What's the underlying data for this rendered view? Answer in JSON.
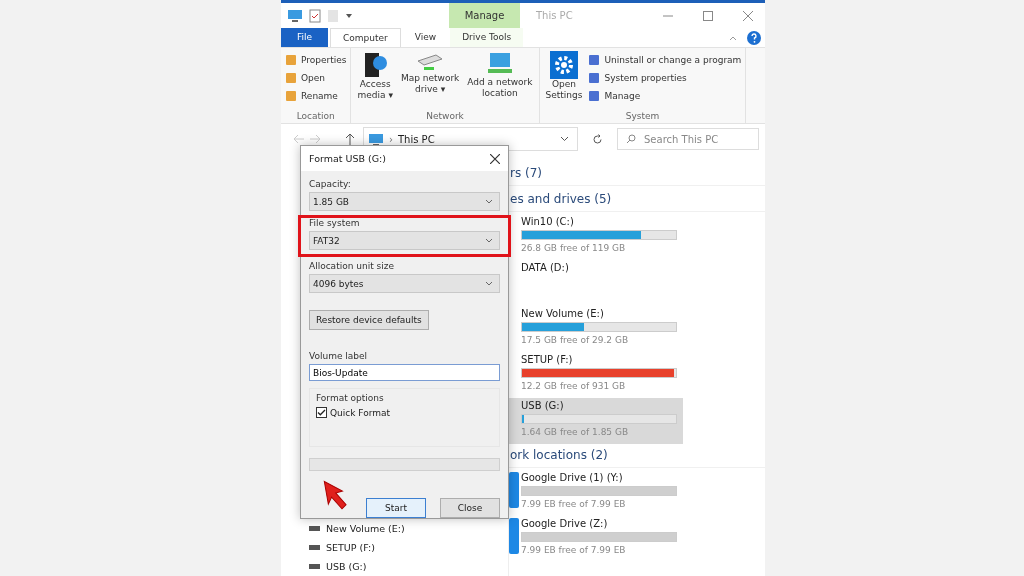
{
  "titlebar": {
    "context_tab": "Manage",
    "title": "This PC"
  },
  "ribbon_tabs": [
    {
      "label": "File",
      "kind": "file",
      "selected": false
    },
    {
      "label": "Computer",
      "kind": "tab",
      "selected": true
    },
    {
      "label": "View",
      "kind": "tab",
      "selected": false
    },
    {
      "label": "Drive Tools",
      "kind": "context",
      "selected": false
    }
  ],
  "ribbon_groups": [
    {
      "label": "Location",
      "items": [
        {
          "kind": "small",
          "lines": [
            "Properties"
          ]
        },
        {
          "kind": "small",
          "lines": [
            "Open"
          ]
        },
        {
          "kind": "small",
          "lines": [
            "Rename"
          ]
        }
      ]
    },
    {
      "label": "Network",
      "items": [
        {
          "kind": "large",
          "lines": [
            "Access",
            "media ▾"
          ]
        },
        {
          "kind": "large",
          "lines": [
            "Map network",
            "drive ▾"
          ]
        },
        {
          "kind": "large",
          "lines": [
            "Add a network",
            "location"
          ]
        }
      ]
    },
    {
      "label": "System",
      "items": [
        {
          "kind": "large",
          "lines": [
            "Open",
            "Settings"
          ]
        },
        {
          "kind": "small",
          "lines": [
            "Uninstall or change a program"
          ]
        },
        {
          "kind": "small",
          "lines": [
            "System properties"
          ]
        },
        {
          "kind": "small",
          "lines": [
            "Manage"
          ]
        }
      ]
    }
  ],
  "address": {
    "separator": "›",
    "path": "This PC",
    "search_placeholder": "Search This PC"
  },
  "nav_pane": [
    "New Volume (E:)",
    "SETUP (F:)",
    "USB (G:)"
  ],
  "sections": [
    {
      "heading": "rs (7)"
    },
    {
      "heading": "es and drives (5)",
      "drives": [
        {
          "kind": "local",
          "name": "Win10 (C:)",
          "level": 0.77,
          "free": "26.8 GB free of 119 GB",
          "selected": false
        },
        {
          "kind": "local",
          "name": "DATA (D:)",
          "selected": false
        },
        {
          "kind": "local",
          "name": "New Volume (E:)",
          "level": 0.4,
          "free": "17.5 GB free of 29.2 GB",
          "selected": false
        },
        {
          "kind": "local",
          "name": "SETUP (F:)",
          "level": 0.99,
          "free": "12.2 GB free of 931 GB",
          "selected": false
        },
        {
          "kind": "local",
          "name": "USB (G:)",
          "level": 0.01,
          "free": "1.64 GB free of 1.85 GB",
          "selected": true
        }
      ]
    },
    {
      "heading": "ork locations (2)",
      "drives": [
        {
          "kind": "network",
          "name": "Google Drive (1) (Y:)",
          "level": 1,
          "free": "7.99 EB free of 7.99 EB",
          "selected": false
        },
        {
          "kind": "network",
          "name": "Google Drive (Z:)",
          "level": 1,
          "free": "7.99 EB free of 7.99 EB",
          "selected": false
        }
      ]
    }
  ],
  "dialog": {
    "title": "Format USB (G:)",
    "fields": [
      {
        "label": "Capacity:",
        "value": "1.85 GB",
        "highlight": false
      },
      {
        "label": "File system",
        "value": "FAT32",
        "highlight": true
      },
      {
        "label": "Allocation unit size",
        "value": "4096 bytes",
        "highlight": false
      }
    ],
    "restore_button": "Restore device defaults",
    "volume_label": {
      "label": "Volume label",
      "value": "Bios-Update"
    },
    "format_options": {
      "label": "Format options",
      "quick_format": {
        "label": "Quick Format",
        "checked": true
      }
    },
    "progress": {
      "level": 0
    },
    "buttons": [
      "Start",
      "Close"
    ]
  }
}
